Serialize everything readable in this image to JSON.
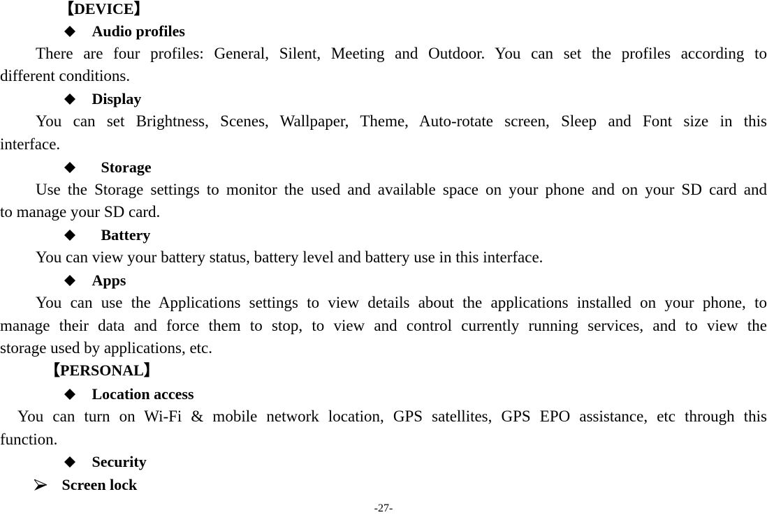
{
  "sections": {
    "device": "【DEVICE】",
    "personal": "【PERSONAL】"
  },
  "items": {
    "audio_profiles": {
      "heading": "Audio profiles",
      "line1": "There are four profiles: General, Silent, Meeting and Outdoor. You can set the profiles according to",
      "line2": "different conditions."
    },
    "display": {
      "heading": "Display",
      "line1": "You can set Brightness, Scenes, Wallpaper, Theme, Auto-rotate screen, Sleep and Font size in this",
      "line2": "interface."
    },
    "storage": {
      "heading": "Storage",
      "line1": "Use the Storage settings to monitor the used and available space on your phone and on your SD card and",
      "line2": "to manage your SD card."
    },
    "battery": {
      "heading": "Battery",
      "line1": "You can view your battery status, battery level and battery use in this interface."
    },
    "apps": {
      "heading": "Apps",
      "line1": "You can use the Applications settings to view details about the applications installed on your phone, to",
      "line2": "manage their data and force them to stop, to view and control currently running services, and to view the",
      "line3": "storage used by applications, etc."
    },
    "location_access": {
      "heading": "Location access",
      "line1": "You can turn on Wi-Fi & mobile network location, GPS satellites, GPS EPO assistance, etc through this",
      "line2": "function."
    },
    "security": {
      "heading": "Security"
    },
    "screen_lock": {
      "heading": "Screen lock"
    }
  },
  "icons": {
    "bullet": "diamond-bullet-icon",
    "sub_bullet": "arrowhead-bullet-icon"
  },
  "footer": {
    "page_number": "-27-"
  }
}
